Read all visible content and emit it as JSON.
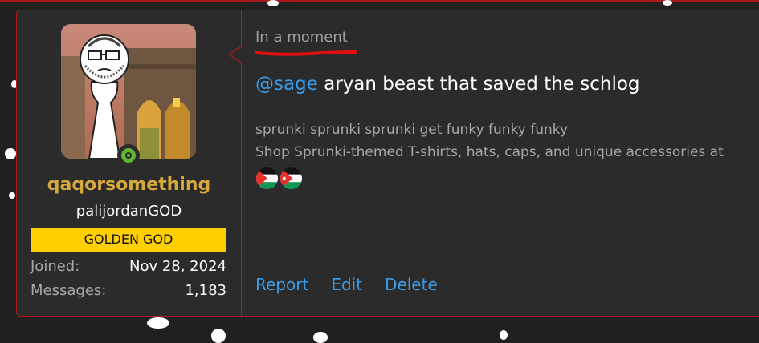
{
  "post": {
    "user": {
      "username": "qaqorsomething",
      "title": "palijordanGOD",
      "badge": "GOLDEN GOD",
      "stats": [
        {
          "label": "Joined:",
          "value": "Nov 28, 2024"
        },
        {
          "label": "Messages:",
          "value": "1,183"
        }
      ],
      "online": true
    },
    "timestamp": "In a moment",
    "message": {
      "mention": "@sage",
      "text": " aryan beast that saved the schlog"
    },
    "signature": {
      "line1": "sprunki sprunki sprunki get funky funky funky",
      "line2": "Shop Sprunki-themed T-shirts, hats, caps, and unique accessories at"
    },
    "actions": {
      "report": "Report",
      "edit": "Edit",
      "delete": "Delete"
    }
  },
  "colors": {
    "accent_red": "#b01c1c",
    "username_gold": "#d6a93c",
    "badge_yellow": "#ffd000",
    "link_blue": "#3b9ae6",
    "online_green": "#63b334"
  }
}
